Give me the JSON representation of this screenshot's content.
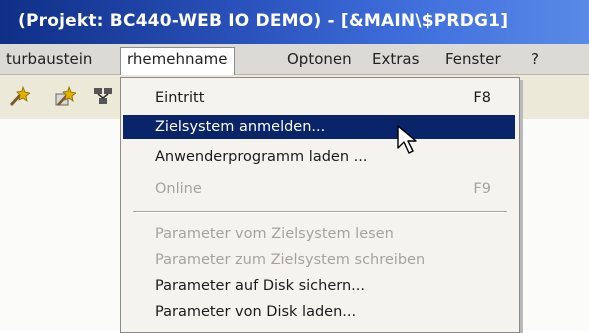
{
  "window": {
    "title": "(Projekt: BC440-WEB IO DEMO) - [&MAIN\\$PRDG1]"
  },
  "menubar": {
    "items": [
      {
        "label": "turbaustein"
      },
      {
        "label": "rhemehname"
      },
      {
        "label": "Optonen"
      },
      {
        "label": "Extras"
      },
      {
        "label": "Fenster"
      },
      {
        "label": "?"
      }
    ]
  },
  "toolbar": {
    "icons": [
      "wizard-icon",
      "wizard-icon",
      "network-icon"
    ]
  },
  "dropdown": {
    "items": [
      {
        "label": "Eintritt",
        "shortcut": "F8",
        "state": "normal"
      },
      {
        "label": "Zielsystem anmelden...",
        "shortcut": "",
        "state": "highlighted"
      },
      {
        "label": "Anwenderprogramm laden ...",
        "shortcut": "",
        "state": "normal"
      },
      {
        "label": "Online",
        "shortcut": "F9",
        "state": "disabled"
      },
      {
        "label": "Parameter vom Zielsystem lesen",
        "shortcut": "",
        "state": "disabled"
      },
      {
        "label": "Parameter zum Zielsystem schreiben",
        "shortcut": "",
        "state": "disabled"
      },
      {
        "label": "Parameter auf Disk sichern...",
        "shortcut": "",
        "state": "normal"
      },
      {
        "label": "Parameter von Disk laden...",
        "shortcut": "",
        "state": "normal"
      }
    ]
  },
  "colors": {
    "titlebar": "#0f2f86",
    "highlight": "#0a246a",
    "menu_bg": "#f4f3ee",
    "disabled_text": "#a5a39c"
  }
}
